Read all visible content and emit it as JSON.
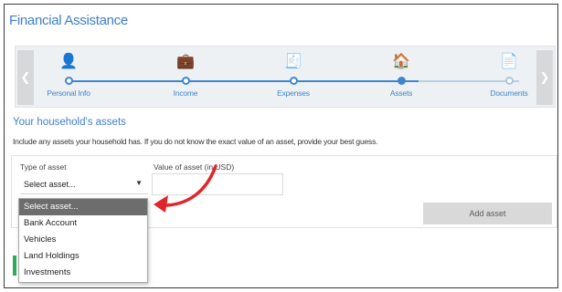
{
  "header": {
    "title": "Financial Assistance"
  },
  "stepper": {
    "prev_icon": "chevron-left-icon",
    "next_icon": "chevron-right-icon",
    "steps": [
      {
        "label": "Personal Info",
        "icon": "person-icon",
        "glyph": "👤",
        "color": "#c2337a",
        "state": "done"
      },
      {
        "label": "Income",
        "icon": "briefcase-icon",
        "glyph": "💼",
        "color": "#6b3b1f",
        "state": "done"
      },
      {
        "label": "Expenses",
        "icon": "receipt-icon",
        "glyph": "🧾",
        "color": "#d4a019",
        "state": "done"
      },
      {
        "label": "Assets",
        "icon": "house-icon",
        "glyph": "🏠",
        "color": "#d0641f",
        "state": "active"
      },
      {
        "label": "Documents",
        "icon": "documents-icon",
        "glyph": "📄",
        "color": "#c7a36a",
        "state": "todo"
      }
    ]
  },
  "assets": {
    "section_title": "Your household's assets",
    "description": "Include any assets your household has. If you do not know the exact value of an asset, provide your best guess.",
    "type_label": "Type of asset",
    "type_value": "Select asset...",
    "value_label": "Value of asset (in USD)",
    "add_button": "Add asset",
    "dropdown_options": [
      "Select asset...",
      "Bank Account",
      "Vehicles",
      "Land Holdings",
      "Investments"
    ],
    "selected_index": 0
  },
  "colors": {
    "accent": "#3e86d0",
    "arrow": "#e0262b",
    "highlight": "#6d6d6d"
  }
}
